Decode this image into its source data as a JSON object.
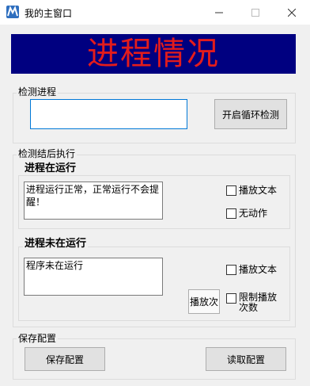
{
  "window": {
    "title": "我的主窗口"
  },
  "banner": {
    "text": "进程情况"
  },
  "monitor": {
    "label": "检测进程",
    "input_value": "",
    "start_button": "开启循环检测"
  },
  "after_detect": {
    "label": "检测结后执行",
    "running": {
      "label": "进程在运行",
      "message": "进程运行正常，正常运行不会提醒！",
      "play_text": "播放文本",
      "no_action": "无动作"
    },
    "not_running": {
      "label": "进程未在运行",
      "message": "程序未在运行",
      "play_text": "播放文本",
      "play_count_button": "播放次",
      "limit_play": "限制播放\n次数"
    }
  },
  "config": {
    "label": "保存配置",
    "save_button": "保存配置",
    "load_button": "读取配置"
  },
  "colors": {
    "banner_bg": "#000080",
    "banner_text": "#e31c1c",
    "focus_border": "#0078d7"
  },
  "icons": {
    "app": "app-logo-icon",
    "minimize": "minimize-icon",
    "maximize": "maximize-icon",
    "close": "close-icon"
  }
}
